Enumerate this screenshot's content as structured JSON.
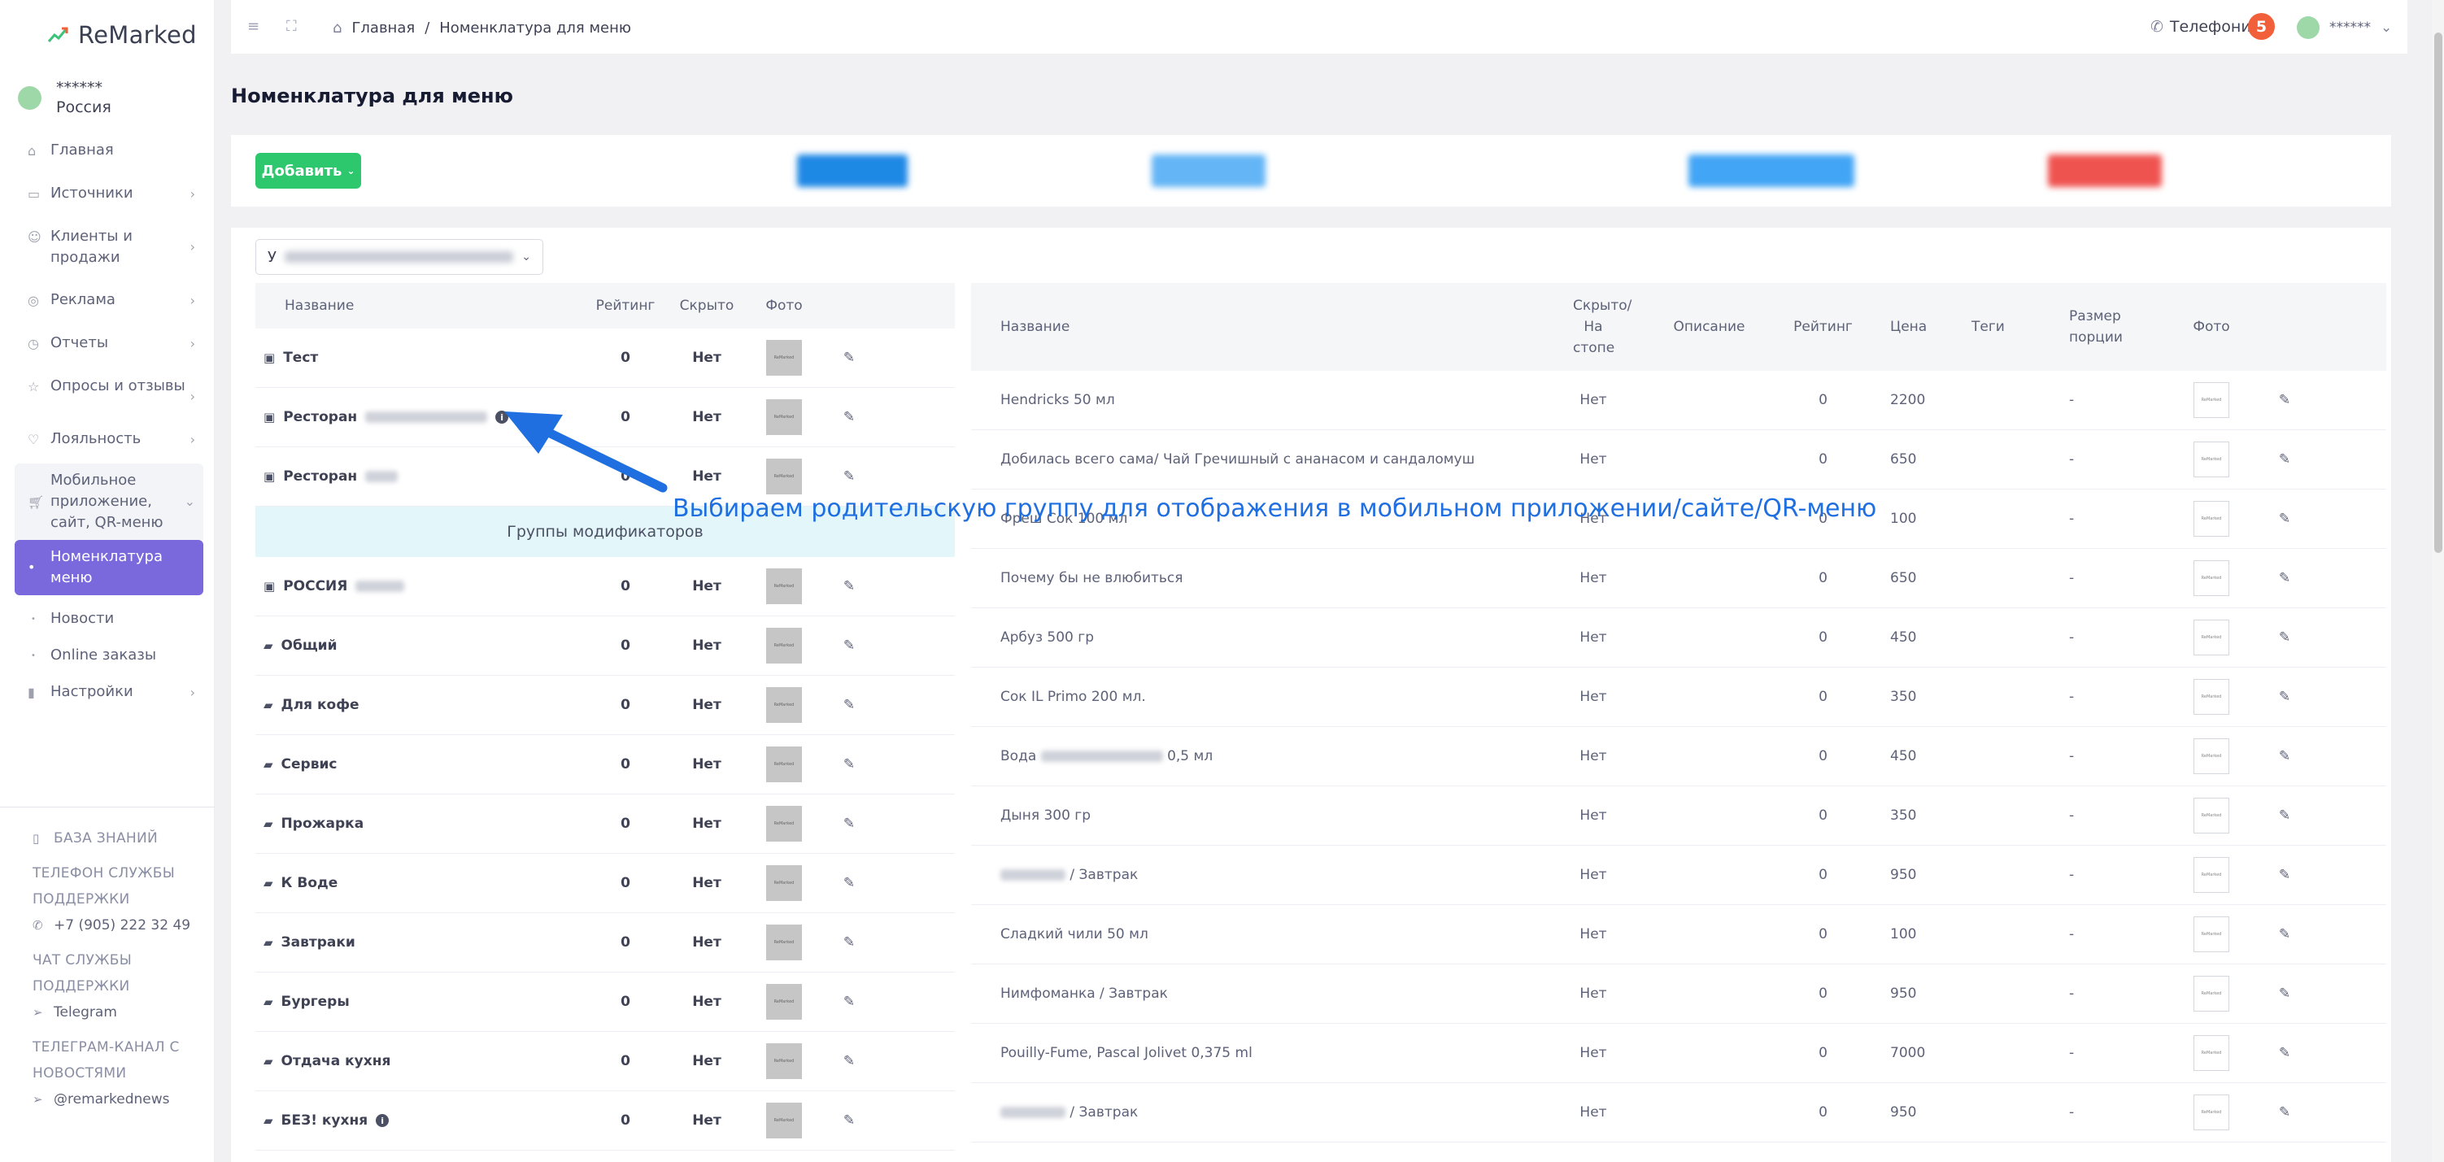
{
  "app": {
    "logo": "ReMarked"
  },
  "user": {
    "name": "******",
    "region": "Россия"
  },
  "sidebar": {
    "items": [
      {
        "label": "Главная",
        "icon": "home-icon",
        "chevron": false
      },
      {
        "label": "Источники",
        "icon": "monitor-icon",
        "chevron": true
      },
      {
        "label": "Клиенты и продажи",
        "icon": "users-icon",
        "chevron": true
      },
      {
        "label": "Реклама",
        "icon": "target-icon",
        "chevron": true
      },
      {
        "label": "Отчеты",
        "icon": "clock-icon",
        "chevron": true
      },
      {
        "label": "Опросы и отзывы",
        "icon": "star-icon",
        "chevron": true
      },
      {
        "label": "Лояльность",
        "icon": "heart-icon",
        "chevron": true
      },
      {
        "label": "Мобильное приложение, сайт, QR-меню",
        "icon": "cart-icon",
        "chevron": true
      },
      {
        "label": "Номенклатура меню",
        "icon": "dot-icon",
        "active": true
      },
      {
        "label": "Новости",
        "icon": "dot-icon"
      },
      {
        "label": "Online заказы",
        "icon": "dot-icon"
      },
      {
        "label": "Настройки",
        "icon": "bookmark-icon",
        "chevron": true
      }
    ],
    "help": {
      "knowledge_base": "БАЗА ЗНАНИЙ",
      "support_phone_caption": "ТЕЛЕФОН СЛУЖБЫ ПОДДЕРЖКИ",
      "support_phone": "+7 (905) 222 32 49",
      "support_chat_caption": "ЧАТ СЛУЖБЫ ПОДДЕРЖКИ",
      "support_chat": "Telegram",
      "channel_caption": "ТЕЛЕГРАМ-КАНАЛ С НОВОСТЯМИ",
      "channel": "@remarkednews"
    }
  },
  "topbar": {
    "breadcrumb": [
      "Главная",
      "Номенклатура для меню"
    ],
    "phone_label": "Телефония",
    "notifications": "5",
    "user_name": "******"
  },
  "page": {
    "title": "Номенклатура для меню"
  },
  "toolbar": {
    "add_label": "Добавить",
    "blurred_buttons": [
      {
        "color": "#1e88e5"
      },
      {
        "color": "#42a5f5"
      },
      {
        "color": "#42a5f5"
      },
      {
        "color": "#ef5350"
      }
    ]
  },
  "selector": {
    "prefix": "У"
  },
  "groups_table": {
    "headers": [
      "Название",
      "Рейтинг",
      "Скрыто",
      "Фото"
    ],
    "rows": [
      {
        "name": "Тест",
        "rating": "0",
        "hidden": "Нет",
        "icon": "archive-icon"
      },
      {
        "name": "Ресторан",
        "rating": "0",
        "hidden": "Нет",
        "icon": "archive-icon",
        "redacted": true,
        "info": true
      },
      {
        "name": "Ресторан",
        "rating": "0",
        "hidden": "Нет",
        "icon": "archive-icon",
        "redacted": true
      },
      {
        "modifier": "Группы модификаторов"
      },
      {
        "name": "РОССИЯ",
        "rating": "0",
        "hidden": "Нет",
        "icon": "archive-icon",
        "redacted": true
      },
      {
        "name": "Общий",
        "rating": "0",
        "hidden": "Нет",
        "icon": "folder-icon"
      },
      {
        "name": "Для кофе",
        "rating": "0",
        "hidden": "Нет",
        "icon": "folder-icon"
      },
      {
        "name": "Сервис",
        "rating": "0",
        "hidden": "Нет",
        "icon": "folder-icon"
      },
      {
        "name": "Прожарка",
        "rating": "0",
        "hidden": "Нет",
        "icon": "folder-icon"
      },
      {
        "name": "К Воде",
        "rating": "0",
        "hidden": "Нет",
        "icon": "folder-icon"
      },
      {
        "name": "Завтраки",
        "rating": "0",
        "hidden": "Нет",
        "icon": "folder-icon"
      },
      {
        "name": "Бургеры",
        "rating": "0",
        "hidden": "Нет",
        "icon": "folder-icon"
      },
      {
        "name": "Отдача кухня",
        "rating": "0",
        "hidden": "Нет",
        "icon": "folder-icon"
      },
      {
        "name": "БЕЗ! кухня",
        "rating": "0",
        "hidden": "Нет",
        "icon": "folder-icon",
        "info": true
      }
    ],
    "thumb_text": "ReMarked"
  },
  "items_table": {
    "headers": {
      "name": "Название",
      "hidden": "Скрыто/ На стопе",
      "description": "Описание",
      "rating": "Рейтинг",
      "price": "Цена",
      "tags": "Теги",
      "size": "Размер порции",
      "photo": "Фото"
    },
    "rows": [
      {
        "name": "Hendricks 50 мл",
        "hidden": "Нет",
        "rating": "0",
        "price": "2200",
        "size": "-"
      },
      {
        "name": "Добилась всего сама/ Чай Гречишный с ананасом и сандаломуш",
        "hidden": "Нет",
        "rating": "0",
        "price": "650",
        "size": "-"
      },
      {
        "name": "Фреш Сок 100 мл",
        "hidden": "Нет",
        "rating": "0",
        "price": "100",
        "size": "-"
      },
      {
        "name": "Почему бы не влюбиться",
        "hidden": "Нет",
        "rating": "0",
        "price": "650",
        "size": "-"
      },
      {
        "name": "Арбуз 500 гр",
        "hidden": "Нет",
        "rating": "0",
        "price": "450",
        "size": "-"
      },
      {
        "name": "Сок IL Primo 200 мл.",
        "hidden": "Нет",
        "rating": "0",
        "price": "350",
        "size": "-"
      },
      {
        "name_start": "Вода",
        "name_end": "0,5 мл",
        "hidden": "Нет",
        "rating": "0",
        "price": "450",
        "size": "-"
      },
      {
        "name": "Дыня 300 гр",
        "hidden": "Нет",
        "rating": "0",
        "price": "350",
        "size": "-"
      },
      {
        "name_end": "/ Завтрак",
        "hidden": "Нет",
        "rating": "0",
        "price": "950",
        "size": "-"
      },
      {
        "name": "Сладкий чили 50 мл",
        "hidden": "Нет",
        "rating": "0",
        "price": "100",
        "size": "-"
      },
      {
        "name": "Нимфоманка / Завтрак",
        "hidden": "Нет",
        "rating": "0",
        "price": "950",
        "size": "-"
      },
      {
        "name": "Pouilly-Fume, Pascal Jolivet 0,375 ml",
        "hidden": "Нет",
        "rating": "0",
        "price": "7000",
        "size": "-"
      },
      {
        "name_end": "/ Завтрак",
        "hidden": "Нет",
        "rating": "0",
        "price": "950",
        "size": "-"
      }
    ],
    "thumb_text": "ReMarked"
  },
  "annotation": {
    "text": "Выбираем родительскую группу для отображения в мобильном приложении/сайте/QR-меню",
    "color": "#1f6fe0"
  },
  "colors": {
    "accent": "#7a68dd",
    "add_button": "#2dc76d",
    "badge": "#f1603a"
  }
}
